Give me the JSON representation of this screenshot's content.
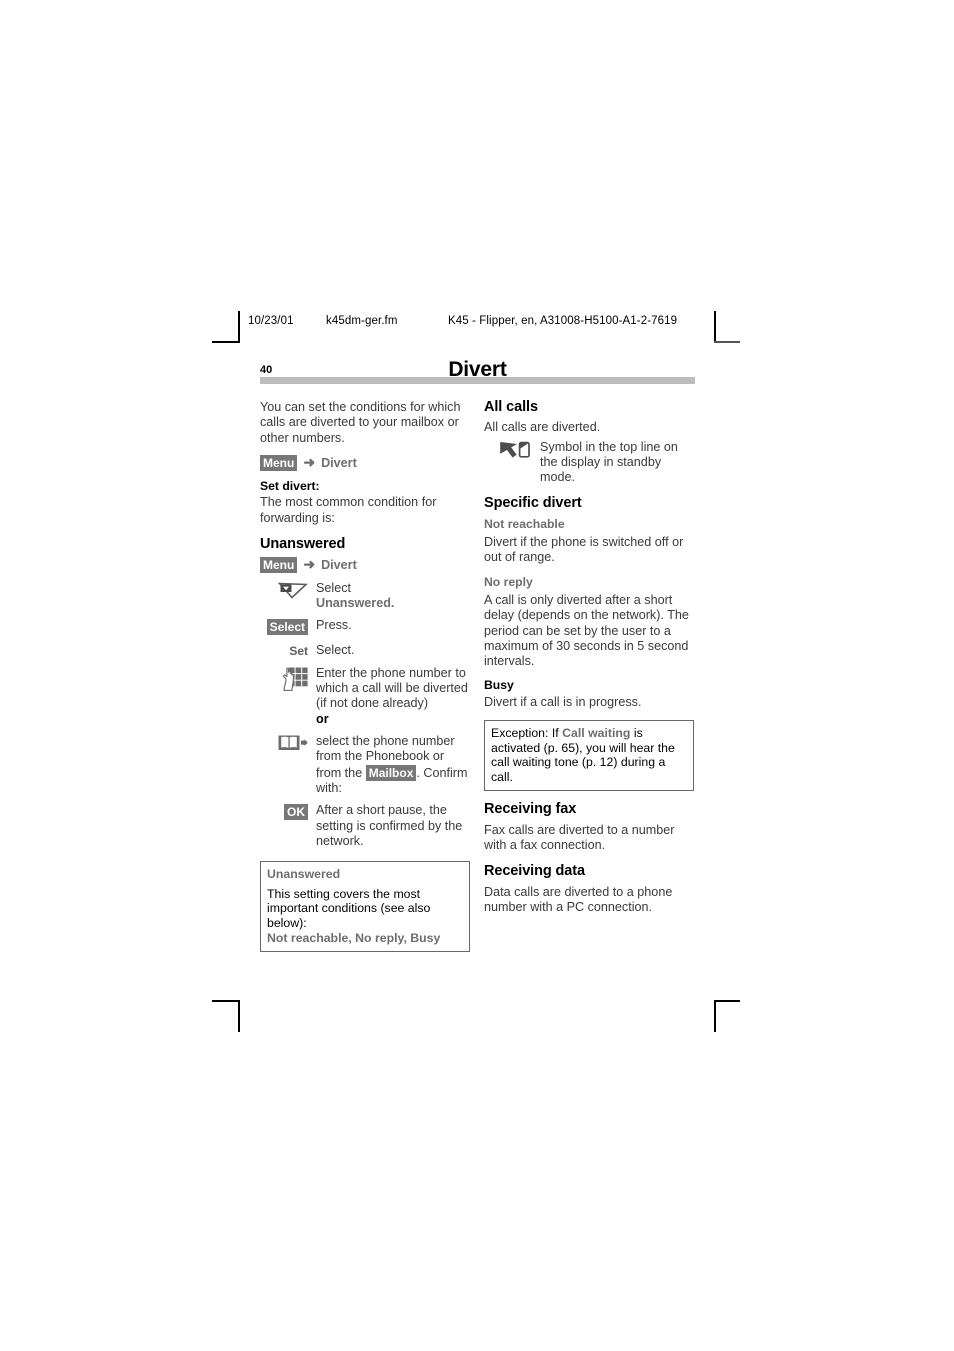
{
  "print_header": {
    "date": "10/23/01",
    "filename": "k45dm-ger.fm",
    "document_id": "K45 - Flipper, en, A31008-H5100-A1-2-7619"
  },
  "page": {
    "number": "40",
    "chapter_title": "Divert"
  },
  "left_column": {
    "intro": "You can set the conditions for which calls are diverted to your mailbox or other numbers.",
    "menu_path_1": {
      "key": "Menu",
      "arrow": "➜",
      "target": "Divert"
    },
    "set_divert_label": "Set divert:",
    "set_divert_text": "The most common condition for forwarding is:",
    "heading_unanswered": "Unanswered",
    "menu_path_2": {
      "key": "Menu",
      "arrow": "➜",
      "target": "Divert"
    },
    "steps": [
      {
        "icon": "navigation-down-key-icon",
        "key_label": "",
        "text": "Select",
        "text_bold_line": "Unanswered."
      },
      {
        "icon": "",
        "key_label": "Select",
        "key_style": "badge",
        "text": "Press."
      },
      {
        "icon": "",
        "key_label": "Set",
        "key_style": "plain",
        "text": "Select."
      },
      {
        "icon": "keypad-icon",
        "key_label": "",
        "text": "Enter the phone number to which a call will be diverted (if not done already)",
        "or_label": "or"
      },
      {
        "icon": "phonebook-icon",
        "key_label": "",
        "text_part1": "select the phone number from the Phonebook or from the ",
        "inline_key": "Mailbox",
        "text_part2": ". Confirm with:"
      },
      {
        "icon": "",
        "key_label": "OK",
        "key_style": "badge",
        "text": "After a short pause, the setting is confirmed by the network."
      }
    ],
    "callout": {
      "title": "Unanswered",
      "body": "This setting covers the most  important conditions (see also below):",
      "footer": "Not reachable, No reply, Busy"
    }
  },
  "right_column": {
    "all_calls": {
      "heading": "All calls",
      "text": "All calls are diverted.",
      "symbol_icon": "divert-symbol-icon",
      "symbol_text": "Symbol in the top line on the display in standby mode."
    },
    "specific_divert": {
      "heading": "Specific divert",
      "items": [
        {
          "label": "Not reachable",
          "label_style": "gray",
          "text": "Divert if the phone is switched off or out of range."
        },
        {
          "label": "No reply",
          "label_style": "gray",
          "text": "A call is only diverted after a short delay (depends on the network). The period can be set by the user to a maximum of 30 seconds in 5 second intervals."
        },
        {
          "label": "Busy",
          "label_style": "black",
          "text": "Divert if a call is in progress."
        }
      ],
      "exception_box": {
        "prefix": "Exception: If ",
        "keyword": "Call waiting",
        "suffix": " is activated (p. 65), you will hear the call waiting tone (p. 12) during a call."
      }
    },
    "receiving_fax": {
      "heading": "Receiving fax",
      "text": "Fax calls are diverted to a number with a fax connection."
    },
    "receiving_data": {
      "heading": "Receiving data",
      "text": "Data calls are diverted to a phone number with a PC connection."
    }
  },
  "colors": {
    "title_rule": "#bcbcbc",
    "key_badge_bg": "#777777",
    "gray_text": "#6e6e6e",
    "body_text": "#3a3a3a"
  }
}
